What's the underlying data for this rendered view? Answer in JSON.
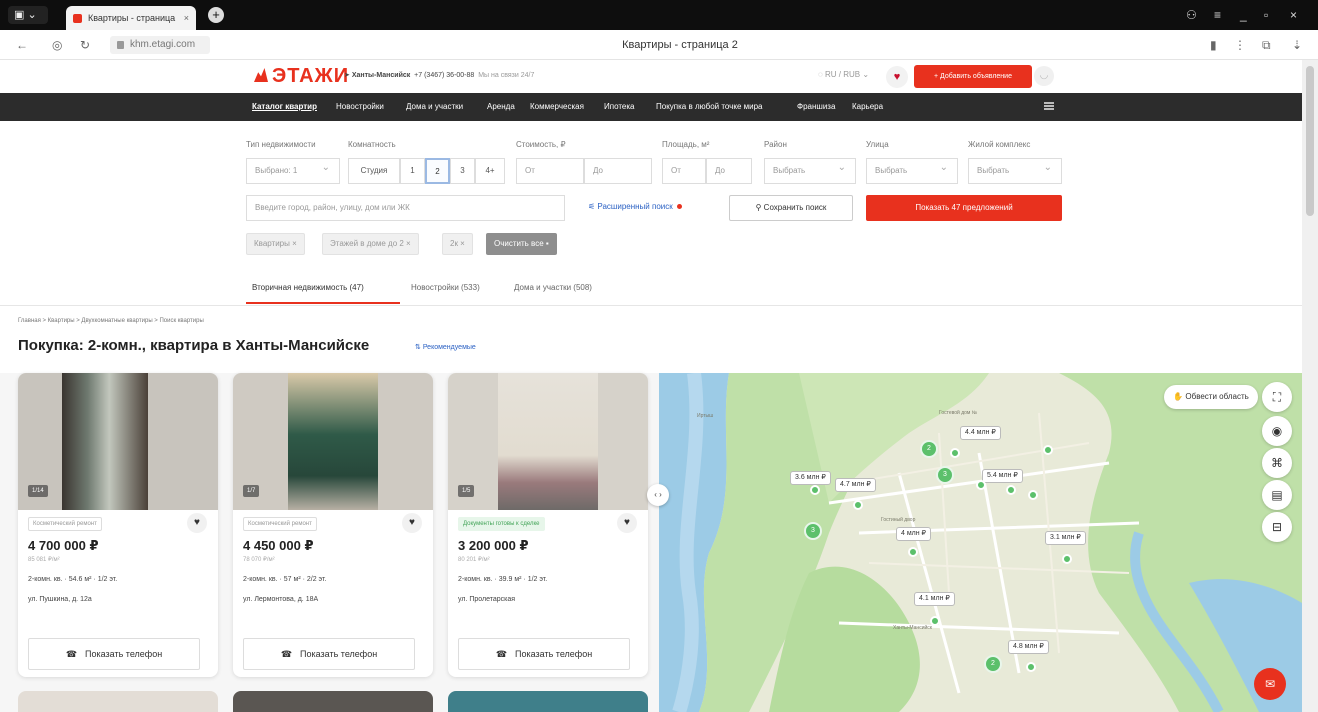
{
  "browser": {
    "tab_title": "Квартиры - страница",
    "url": "khm.etagi.com",
    "page_title": "Квартиры - страница 2"
  },
  "header": {
    "logo": "ЭТАЖИ",
    "city": "Ханты-Мансийск",
    "phone": "+7 (3467) 36-00-88",
    "hours": "Мы на связи 24/7",
    "lang": "RU / RUB",
    "add_listing": "+ Добавить объявление"
  },
  "nav": [
    "Каталог квартир",
    "Новостройки",
    "Дома и участки",
    "Аренда",
    "Коммерческая",
    "Ипотека",
    "Покупка в любой точке мира",
    "Франшиза",
    "Карьера"
  ],
  "filters": {
    "type_label": "Тип недвижимости",
    "type_value": "Выбрано: 1",
    "rooms_label": "Комнатность",
    "rooms": [
      "Студия",
      "1",
      "2",
      "3",
      "4+"
    ],
    "rooms_selected": "2",
    "price_label": "Стоимость, ₽",
    "from": "От",
    "to": "До",
    "area_label": "Площадь, м²",
    "district_label": "Район",
    "street_label": "Улица",
    "complex_label": "Жилой комплекс",
    "choose": "Выбрать",
    "address_placeholder": "Введите город, район, улицу, дом или ЖК",
    "advanced": "Расширенный поиск",
    "save": "Сохранить поиск",
    "show": "Показать 47 предложений"
  },
  "chips": [
    "Квартиры ×",
    "Этажей в доме до 2 ×",
    "2к ×",
    "Очистить все"
  ],
  "section_tabs": [
    "Вторичная недвижимость (47)",
    "Новостройки (533)",
    "Дома и участки (508)"
  ],
  "breadcrumb": "Главная  >  Квартиры  >  Двухкомнатные квартиры  >  Поиск квартиры",
  "h1": "Покупка: 2-комн., квартира в Ханты-Мансийске",
  "sort": "Рекомендуемые",
  "cards": [
    {
      "photo_count": "1/14",
      "repair": "Косметический ремонт",
      "price": "4 700 000 ₽",
      "ppm": "85 081 ₽/м²",
      "params": "2-комн. кв.  ·  54.6 м²  ·  1/2 эт.",
      "street": "ул. Пушкина, д. 12а",
      "phone": "Показать телефон"
    },
    {
      "photo_count": "1/7",
      "repair": "Косметический ремонт",
      "price": "4 450 000 ₽",
      "ppm": "78 070 ₽/м²",
      "params": "2-комн. кв.  ·  57 м²  ·  2/2 эт.",
      "street": "ул. Лермонтова, д. 18А",
      "phone": "Показать телефон"
    },
    {
      "photo_count": "1/5",
      "repair": "Документы готовы к сделке",
      "price": "3 200 000 ₽",
      "ppm": "80 201 ₽/м²",
      "params": "2-комн. кв.  ·  39.9 м²  ·  1/2 эт.",
      "street": "ул. Пролетарская",
      "phone": "Показать телефон"
    }
  ],
  "map": {
    "area_btn": "Обвести область",
    "prices": [
      "4.4 млн ₽",
      "3.6 млн ₽",
      "4.7 млн ₽",
      "5.4 млн ₽",
      "3.1 млн ₽",
      "4 млн ₽",
      "4.1 млн ₽",
      "4.8 млн ₽"
    ],
    "clusters": [
      "2",
      "3",
      "3",
      "2"
    ],
    "labels": [
      "Гостевой дом №",
      "Иртыш",
      "Гостиный двор",
      "Ханты-Мансийск"
    ]
  },
  "colors": {
    "brand": "#e8311e",
    "link": "#2c62c4",
    "map_pin": "#5cc06b"
  }
}
